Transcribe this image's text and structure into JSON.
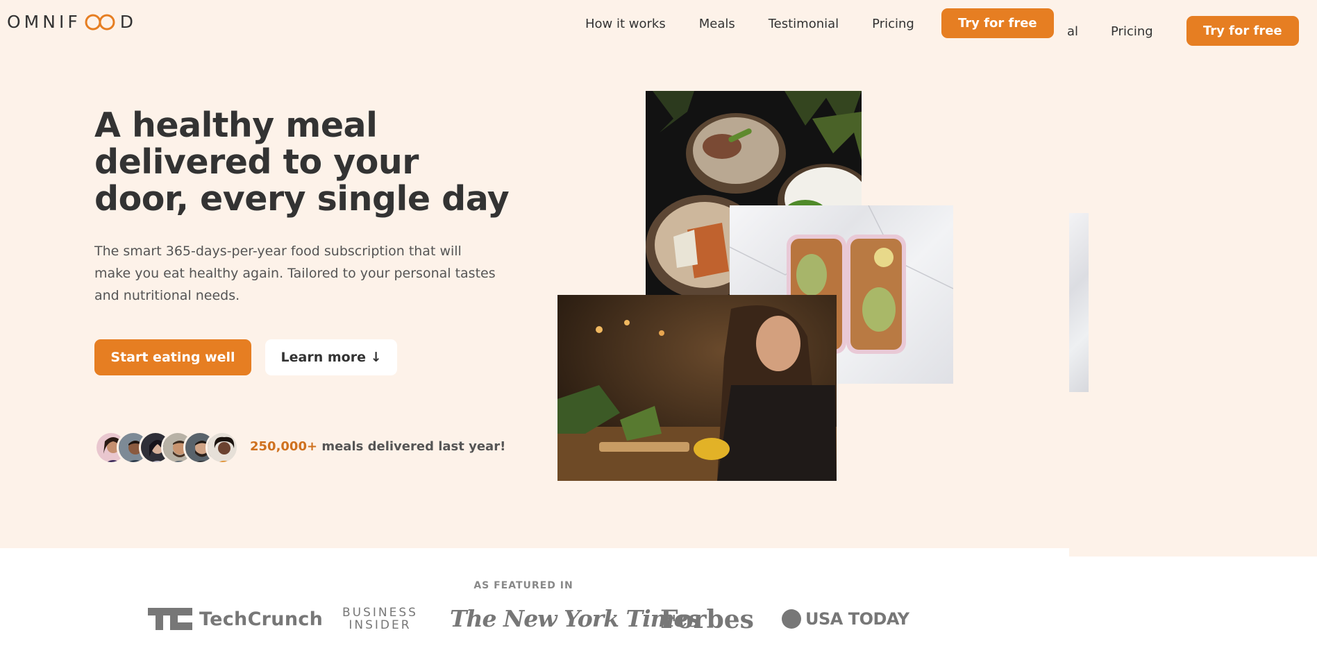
{
  "brand": {
    "logo_text_left": "OMNIF",
    "logo_text_right": "D",
    "accent": "#e67e22",
    "background": "#fdf2e9"
  },
  "nav": {
    "items": [
      "How it works",
      "Meals",
      "Testimonial",
      "Pricing"
    ],
    "cta": "Try for free"
  },
  "ghost_nav": {
    "partial": "al",
    "pricing": "Pricing",
    "cta": "Try for free"
  },
  "hero": {
    "title": "A healthy meal delivered to your door, every single day",
    "description": "The smart 365-days-per-year food subscription that will make you eat healthy again. Tailored to your personal tastes and nutritional needs.",
    "primary_button": "Start eating well",
    "secondary_button": "Learn more ↓",
    "delivered_count": "250,000+",
    "delivered_text": " meals delivered last year!",
    "avatar_count": 6
  },
  "featured": {
    "label": "AS FEATURED IN",
    "logos": [
      "TechCrunch",
      "BUSINESS",
      "INSIDER",
      "The New York Times",
      "Forbes",
      "USA TODAY"
    ]
  }
}
